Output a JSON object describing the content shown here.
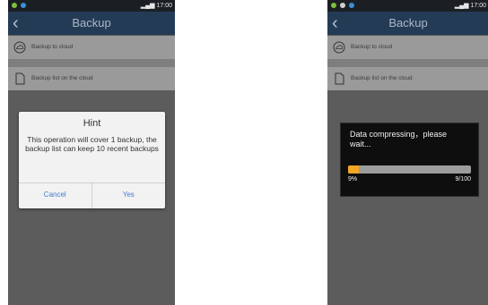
{
  "left": {
    "status_time": "17:00",
    "title": "Backup",
    "rows": [
      {
        "label": "Backup to cloud"
      },
      {
        "label": "Backup list on the cloud"
      }
    ],
    "dialog": {
      "title": "Hint",
      "message": "This operation will cover 1 backup, the backup list can keep 10 recent backups",
      "cancel": "Cancel",
      "yes": "Yes"
    }
  },
  "right": {
    "status_time": "17:00",
    "title": "Backup",
    "rows": [
      {
        "label": "Backup to cloud"
      },
      {
        "label": "Backup list on the cloud"
      }
    ],
    "progress": {
      "message": "Data compressing，please wait...",
      "percent_label": "9%",
      "count_label": "9/100",
      "fraction": 0.09
    }
  },
  "colors": {
    "accent": "#3a7bd5",
    "progress": "#f5a623",
    "appbar": "#243b55"
  }
}
